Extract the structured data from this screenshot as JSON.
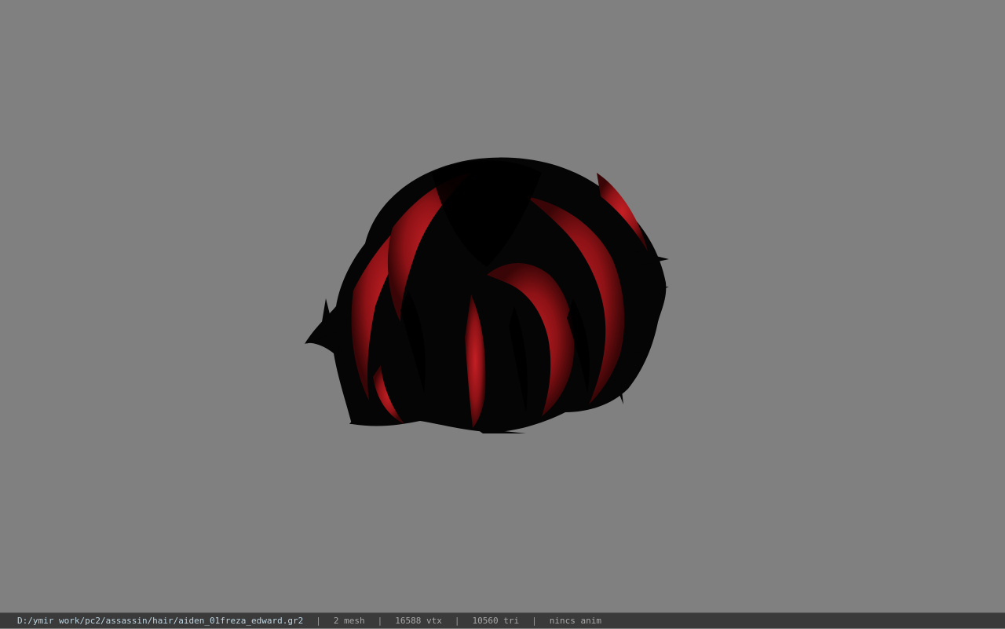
{
  "viewer": {
    "background_color": "#808080",
    "model": {
      "icon": "hair-mesh-render",
      "shadow_color": "#000000",
      "highlight_color": "#b8191e"
    }
  },
  "status_bar": {
    "file_path": "D:/ymir work/pc2/assassin/hair/aiden_01freza_edward.gr2",
    "separator": "|",
    "mesh_count": "2 mesh",
    "vertex_count": "16588 vtx",
    "triangle_count": "10560 tri",
    "animation": "nincs anim"
  }
}
